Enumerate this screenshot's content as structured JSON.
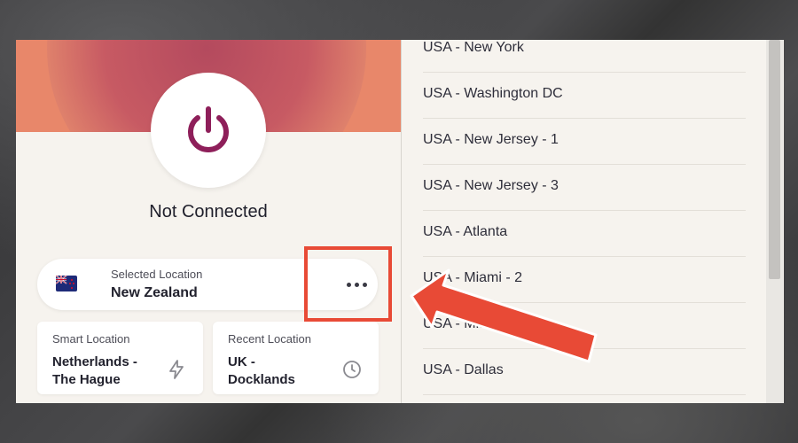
{
  "vpn": {
    "status": "Not Connected",
    "selected_location": {
      "caption": "Selected Location",
      "value": "New Zealand"
    },
    "smart_location": {
      "caption": "Smart Location",
      "value": "Netherlands - The Hague"
    },
    "recent_location": {
      "caption": "Recent Location",
      "value": "UK - Docklands"
    }
  },
  "locations": {
    "items": [
      {
        "label": "USA - New York"
      },
      {
        "label": "USA - Washington DC"
      },
      {
        "label": "USA - New Jersey - 1"
      },
      {
        "label": "USA - New Jersey - 3"
      },
      {
        "label": "USA - Atlanta"
      },
      {
        "label": "USA - Miami - 2"
      },
      {
        "label": "USA - Miami"
      },
      {
        "label": "USA - Dallas"
      }
    ]
  },
  "colors": {
    "accent": "#8e1f5a",
    "annotation": "#e84a36",
    "panel_bg": "#f6f3ee"
  }
}
